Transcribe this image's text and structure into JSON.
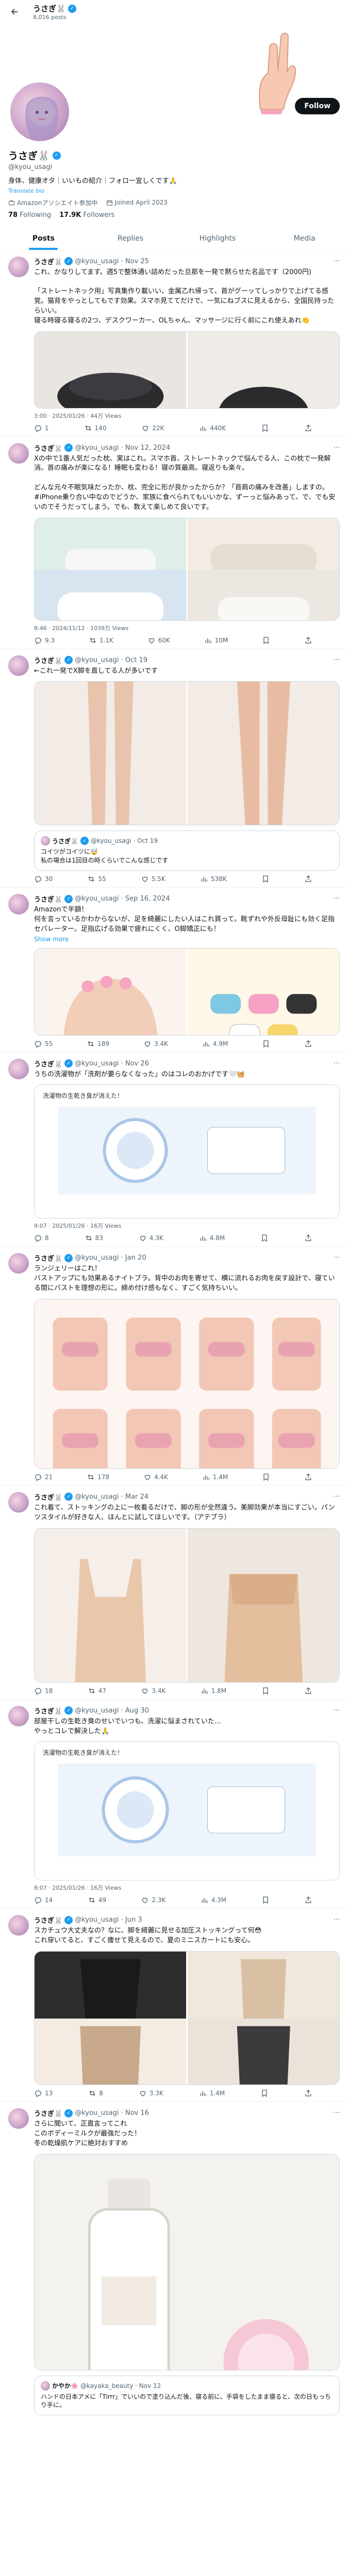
{
  "topbar": {
    "name": "うさぎ🐰",
    "post_count": "8,016 posts"
  },
  "profile": {
    "name": "うさぎ🐰",
    "handle": "@kyou_usagi",
    "follow_label": "Follow",
    "bio": "身体、健康オタ｜いいもの紹介｜フォロー宜しくです🙏",
    "translate": "Translate bio",
    "category": "Amazonアソシエイト参加中",
    "joined": "Joined April 2023",
    "following_count": "78",
    "following_label": "Following",
    "followers_count": "17.9K",
    "followers_label": "Followers"
  },
  "tabs": [
    "Posts",
    "Replies",
    "Highlights",
    "Media"
  ],
  "posts": [
    {
      "name": "うさぎ🐰",
      "handle": "@kyou_usagi · Nov 25",
      "text": "これ、かなりしてます。週5で整体通い詰めだった旦那を一発で黙らせた名品です（2000円)\n\n「ストレートネック用」写真集作り載いい、金属乙れ帰って、首がグーッてしっかりで上げてる感覚。猫背をやっとしてもです効果。スマホ見ててだけで、一気にねブスに見えるから、全国民持ったらいい。\n寝る時寝る寝るの2つ、デスクワーカー、OLちゃん、マッサージに行く前にこれ使えあれ👏",
      "timestamp": "3:00 · 2025/01/26 · 44万 Views",
      "replies": "1",
      "reposts": "140",
      "likes": "22K",
      "views": "440K"
    },
    {
      "name": "うさぎ🐰",
      "handle": "@kyou_usagi · Nov 12, 2024",
      "text": "Xの中で1番人気だった枕、実はこれ。スマホ首、ストレートネックで悩んでる人、この枕で一発解消。首の痛みが楽になる！睡眠も変わる！寝の質最高。寝返りも楽々。\n\nどんな元々不眠気味だったか、枕、完全に形が良かったからか？「首肩の痛みを改善」しますの。#iPhone乗り合い中なのでどうか、家族に食べられてもいいかな、ずーっと悩みあって、で、でも安いのでそうだってしまう。でも、数えて楽しめて良いです。",
      "timestamp": "8:46 · 2024/11/12 · 1039万 Views",
      "replies": "9.3",
      "reposts": "1.1K",
      "likes": "60K",
      "views": "10M"
    },
    {
      "name": "うさぎ🐰",
      "handle": "@kyou_usagi · Oct 19",
      "text": "←これ一発でX脚を直してる人が多いです",
      "timestamp": "",
      "replies": "30",
      "reposts": "55",
      "likes": "5.5K",
      "views": "538K",
      "quote": {
        "name": "うさぎ🐰",
        "handle": "@kyou_usagi · Oct 19",
        "text": "コイツがコイツに🤯\n私の場合は1回目の時くらいでこんな感じです"
      }
    },
    {
      "name": "うさぎ🐰",
      "handle": "@kyou_usagi · Sep 16, 2024",
      "text": "Amazonで半額！\n何を言っているかわからないが、足を綺麗にしたい人はこれ買って。靴ずれや外反母趾にも効く足指セパレーター。足指広げる効果で疲れにくく、O脚矯正にも！",
      "show_more": "Show more",
      "timestamp": "",
      "replies": "55",
      "reposts": "189",
      "likes": "3.4K",
      "views": "4.9M"
    },
    {
      "name": "うさぎ🐰",
      "handle": "@kyou_usagi · Nov 26",
      "text": "うちの洗濯物が「洗剤が要らなくなった」のはコレのおかげです🤍🧺",
      "timestamp": "9:07 · 2025/01/26 · 16万 Views",
      "replies": "8",
      "reposts": "83",
      "likes": "4.3K",
      "views": "4.8M",
      "inner_caption": "洗濯物の生乾き臭が消えた！"
    },
    {
      "name": "うさぎ🐰",
      "handle": "@kyou_usagi · Jan 20",
      "text": "ランジェリーはこれ！\nバストアップにも効果あるナイトブラ。背中のお肉を寄せて、横に流れるお肉を戻す設計で、寝ている間にバストを理想の形に。締め付け感もなく、すごく気持ちいい。",
      "timestamp": "",
      "replies": "21",
      "reposts": "178",
      "likes": "4.4K",
      "views": "1.4M"
    },
    {
      "name": "うさぎ🐰",
      "handle": "@kyou_usagi · Mar 24",
      "text": "これ着て、ストッキングの上に一枚着るだけで、脚の形が全然違う。美脚効果が本当にすごい。パンツスタイルが好きな人、ほんとに試してほしいです。（アテブラ）",
      "timestamp": "",
      "replies": "18",
      "reposts": "47",
      "likes": "3.4K",
      "views": "1.8M"
    },
    {
      "name": "うさぎ🐰",
      "handle": "@kyou_usagi · Aug 30",
      "text": "部屋干しの生乾き臭のせいでいつも、洗濯に悩まされていた...\nやっとコレで解決した🙏",
      "timestamp": "8:07 · 2025/01/26 · 16万 Views",
      "replies": "14",
      "reposts": "49",
      "likes": "2.3K",
      "views": "4.3M",
      "inner_caption": "洗濯物の生乾き臭が消えた！"
    },
    {
      "name": "うさぎ🐰",
      "handle": "@kyou_usagi · Jun 3",
      "text": "スカチュウ大丈夫なの？なに、脚を綺麗に見せる加圧ストッキングって何😳\nこれ穿いてると、すごく痩せて見えるので、夏のミニスカートにも安心。",
      "timestamp": "",
      "replies": "13",
      "reposts": "8",
      "likes": "3.3K",
      "views": "1.4M"
    },
    {
      "name": "うさぎ🐰",
      "handle": "@kyou_usagi · Nov 16",
      "text": "さらに聞いて、正直言ってこれ\nこのボディーミルクが最強だった！\n冬の乾燥肌ケアに絶対おすすめ",
      "timestamp": "",
      "replies": "",
      "reposts": "",
      "likes": "",
      "views": "",
      "quote": {
        "name": "かやか🌸",
        "handle": "@kayaka_beauty · Nov 12",
        "text": "ハンドの日本アメに「Tirrr」でいいので塗り込んだ後、寝る前に、手袋をしたまま寝ると、次の日もっちり手に。"
      }
    }
  ]
}
